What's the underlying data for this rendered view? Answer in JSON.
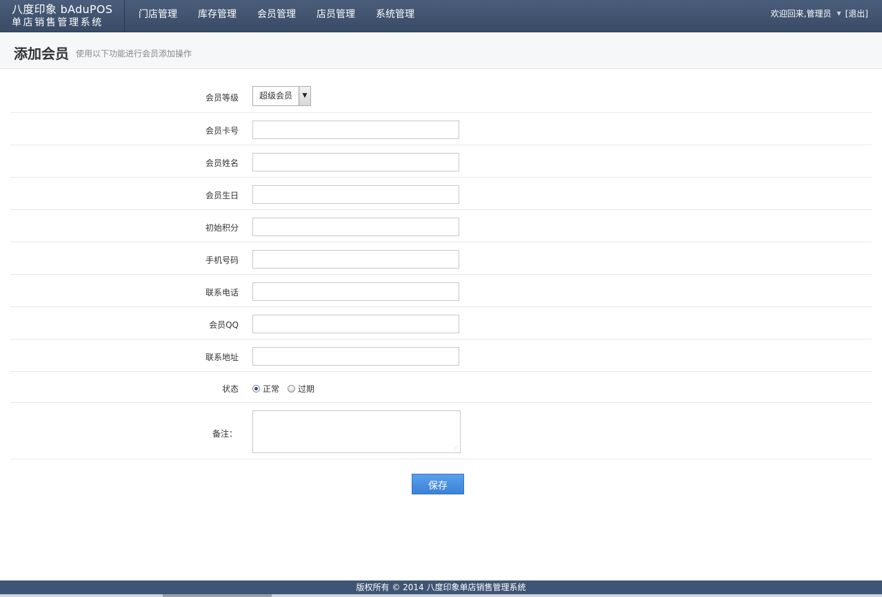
{
  "brand": {
    "line1": "八度印象 bAduPOS",
    "line2": "单店销售管理系统"
  },
  "nav": [
    "门店管理",
    "库存管理",
    "会员管理",
    "店员管理",
    "系统管理"
  ],
  "user": {
    "welcome": "欢迎回来,管理员",
    "logout": "[退出]"
  },
  "page": {
    "title": "添加会员",
    "subtitle": "使用以下功能进行会员添加操作"
  },
  "form": {
    "level": {
      "label": "会员等级",
      "value": "超级会员"
    },
    "card_no": {
      "label": "会员卡号",
      "value": ""
    },
    "name": {
      "label": "会员姓名",
      "value": ""
    },
    "birthday": {
      "label": "会员生日",
      "value": ""
    },
    "points": {
      "label": "初始积分",
      "value": ""
    },
    "mobile": {
      "label": "手机号码",
      "value": ""
    },
    "phone": {
      "label": "联系电话",
      "value": ""
    },
    "qq": {
      "label": "会员QQ",
      "value": ""
    },
    "address": {
      "label": "联系地址",
      "value": ""
    },
    "status": {
      "label": "状态",
      "options": [
        "正常",
        "过期"
      ],
      "selected": "正常"
    },
    "remark": {
      "label": "备注：",
      "value": ""
    }
  },
  "save_label": "保存",
  "footer": "版权所有 © 2014 八度印象单店销售管理系统",
  "colors": {
    "topbar": "#3f5575",
    "accent": "#3b82d8"
  }
}
